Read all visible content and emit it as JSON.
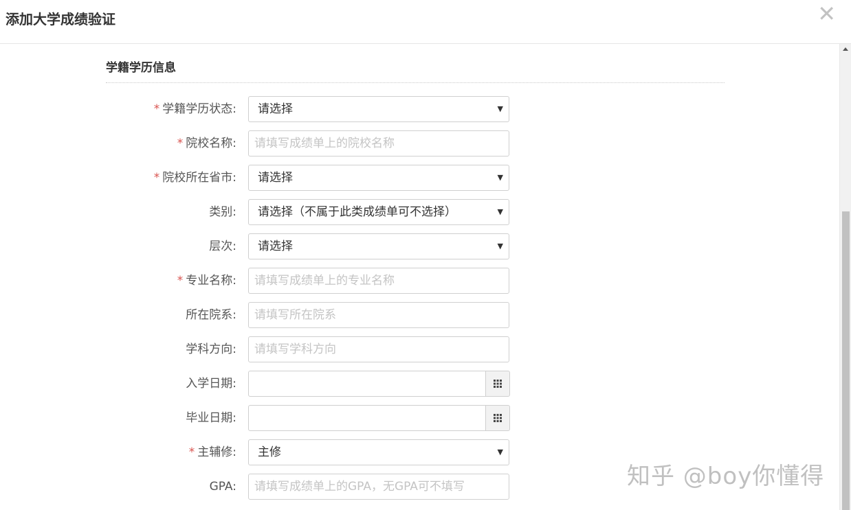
{
  "dialog": {
    "title": "添加大学成绩验证",
    "close_symbol": "✕"
  },
  "section": {
    "title": "学籍学历信息"
  },
  "fields": {
    "status": {
      "label": "学籍学历状态:",
      "required": true,
      "value": "请选择"
    },
    "school_name": {
      "label": "院校名称:",
      "required": true,
      "placeholder": "请填写成绩单上的院校名称"
    },
    "school_province": {
      "label": "院校所在省市:",
      "required": true,
      "value": "请选择"
    },
    "category": {
      "label": "类别:",
      "required": false,
      "value": "请选择（不属于此类成绩单可不选择）"
    },
    "level": {
      "label": "层次:",
      "required": false,
      "value": "请选择"
    },
    "major": {
      "label": "专业名称:",
      "required": true,
      "placeholder": "请填写成绩单上的专业名称"
    },
    "department": {
      "label": "所在院系:",
      "required": false,
      "placeholder": "请填写所在院系"
    },
    "direction": {
      "label": "学科方向:",
      "required": false,
      "placeholder": "请填写学科方向"
    },
    "enroll_date": {
      "label": "入学日期:",
      "required": false,
      "value": ""
    },
    "grad_date": {
      "label": "毕业日期:",
      "required": false,
      "value": ""
    },
    "major_minor": {
      "label": "主辅修:",
      "required": true,
      "value": "主修"
    },
    "gpa": {
      "label": "GPA:",
      "required": false,
      "placeholder": "请填写成绩单上的GPA，无GPA可不填写"
    }
  },
  "required_mark": "*",
  "caret_symbol": "▼",
  "calendar_icon": "calendar-grid-icon",
  "watermark": "知乎 @boy你懂得"
}
